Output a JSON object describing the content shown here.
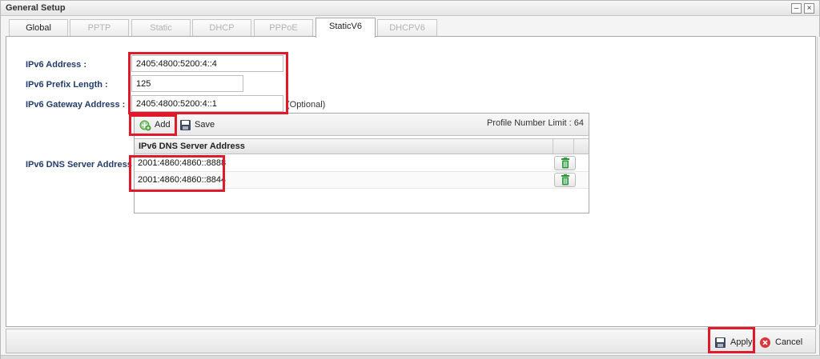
{
  "window": {
    "title": "General Setup",
    "minimize_glyph": "–",
    "close_glyph": "×"
  },
  "tabs": [
    {
      "label": "Global",
      "enabled": true,
      "active": false
    },
    {
      "label": "PPTP",
      "enabled": false,
      "active": false
    },
    {
      "label": "Static",
      "enabled": false,
      "active": false
    },
    {
      "label": "DHCP",
      "enabled": false,
      "active": false
    },
    {
      "label": "PPPoE",
      "enabled": false,
      "active": false
    },
    {
      "label": "StaticV6",
      "enabled": true,
      "active": true
    },
    {
      "label": "DHCPV6",
      "enabled": false,
      "active": false
    }
  ],
  "form": {
    "ipv6_address_label": "IPv6 Address :",
    "ipv6_address_value": "2405:4800:5200:4::4",
    "prefix_length_label": "IPv6 Prefix Length :",
    "prefix_length_value": "125",
    "gateway_label": "IPv6 Gateway Address :",
    "gateway_value": "2405:4800:5200:4::1",
    "gateway_optional": "(Optional)",
    "dns_label": "IPv6 DNS Server Address"
  },
  "dns_grid": {
    "add_label": "Add",
    "save_label": "Save",
    "profile_limit": "Profile Number Limit :  64",
    "column_header": "IPv6 DNS Server Address",
    "rows": [
      {
        "address": "2001:4860:4860::8888"
      },
      {
        "address": "2001:4860:4860::8844"
      }
    ]
  },
  "footer": {
    "apply_label": "Apply",
    "cancel_label": "Cancel"
  },
  "colors": {
    "highlight": "#e0192b",
    "label": "#223c6b",
    "add_icon": "#4aa33c",
    "delete_icon": "#2e9a3e",
    "cancel_icon": "#d9363a"
  }
}
